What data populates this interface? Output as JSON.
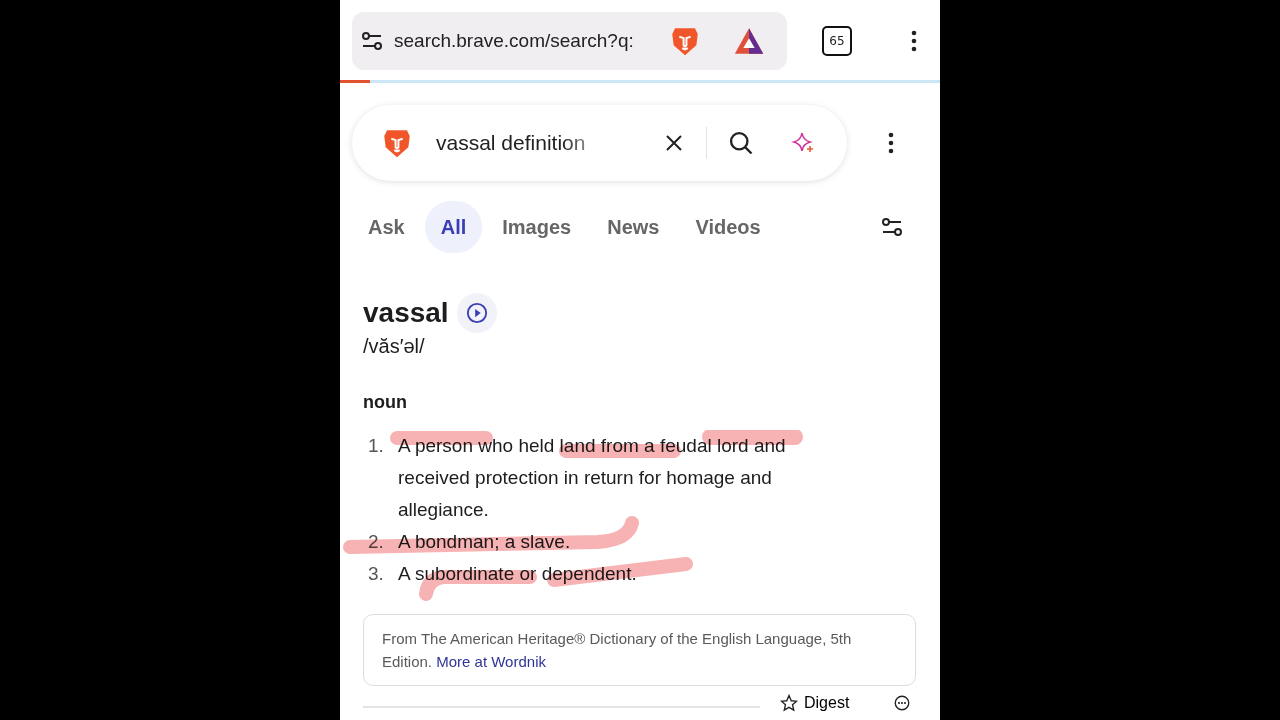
{
  "browser_bar": {
    "url": "search.brave.com/search?q:",
    "tab_count": "65",
    "level": 0.05
  },
  "search": {
    "value": "vassal definition"
  },
  "tabs": [
    {
      "label": "Ask",
      "selected": false
    },
    {
      "label": "All",
      "selected": true
    },
    {
      "label": "Images",
      "selected": false
    },
    {
      "label": "News",
      "selected": false
    },
    {
      "label": "Videos",
      "selected": false
    }
  ],
  "definition": {
    "word": "vassal",
    "pronunciation": "/văs′əl/",
    "part_of_speech": "noun",
    "senses": [
      {
        "number": "1.",
        "text": "A person who held land from a feudal lord and received protection in return for homage and allegiance."
      },
      {
        "number": "2.",
        "text": "A bondman; a slave."
      },
      {
        "number": "3.",
        "text": "A subordinate or dependent."
      }
    ],
    "source": {
      "text": "From The American Heritage® Dictionary of the English Language, 5th Edition.",
      "link": "More at Wordnik"
    }
  },
  "footer": {
    "digest": "Digest"
  }
}
